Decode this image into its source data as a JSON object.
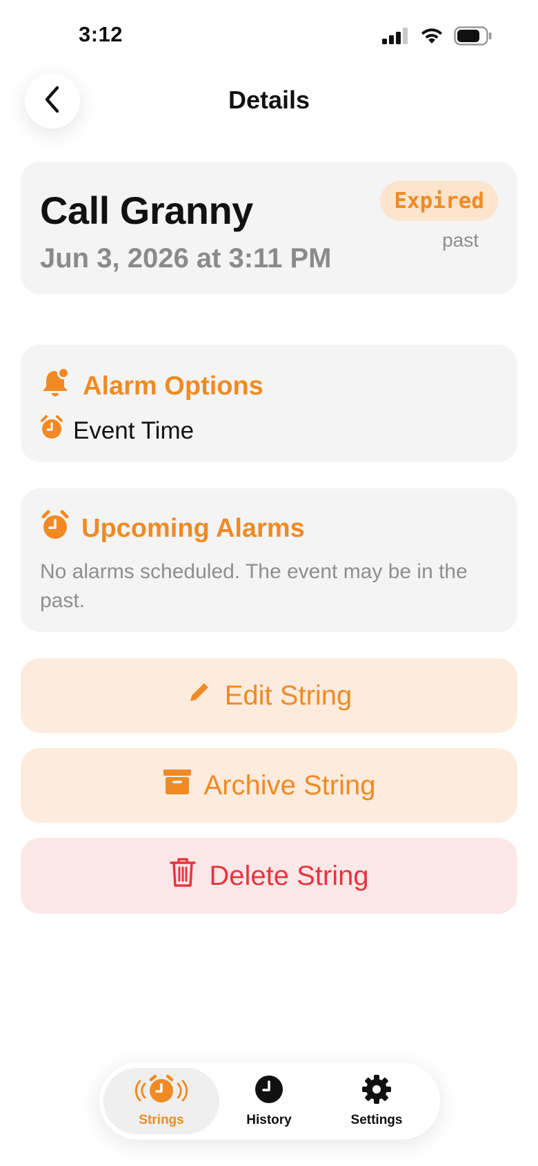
{
  "status_bar": {
    "time": "3:12"
  },
  "nav": {
    "title": "Details",
    "back_icon": "chevron-left-icon"
  },
  "event": {
    "title": "Call Granny",
    "date": "Jun 3, 2026 at 3:11 PM",
    "status_label": "Expired",
    "status_sub": "past"
  },
  "alarm_options": {
    "heading": "Alarm Options",
    "heading_icon": "bell-badge-icon",
    "item_label": "Event Time",
    "item_icon": "alarm-clock-icon"
  },
  "upcoming_alarms": {
    "heading": "Upcoming Alarms",
    "heading_icon": "alarm-clock-icon",
    "description": "No alarms scheduled. The event may be in the past."
  },
  "actions": {
    "edit_label": "Edit String",
    "archive_label": "Archive String",
    "delete_label": "Delete String"
  },
  "tab_bar": {
    "items": [
      {
        "label": "Strings",
        "icon": "ringing-alarm-icon",
        "active": true
      },
      {
        "label": "History",
        "icon": "clock-icon",
        "active": false
      },
      {
        "label": "Settings",
        "icon": "gear-icon",
        "active": false
      }
    ]
  },
  "colors": {
    "accent": "#f08a24",
    "accent_bg": "#fdebdd",
    "danger": "#e8343e",
    "danger_bg": "#fce7e8",
    "card_bg": "#f4f4f4",
    "muted_text": "#8e8e8e"
  }
}
